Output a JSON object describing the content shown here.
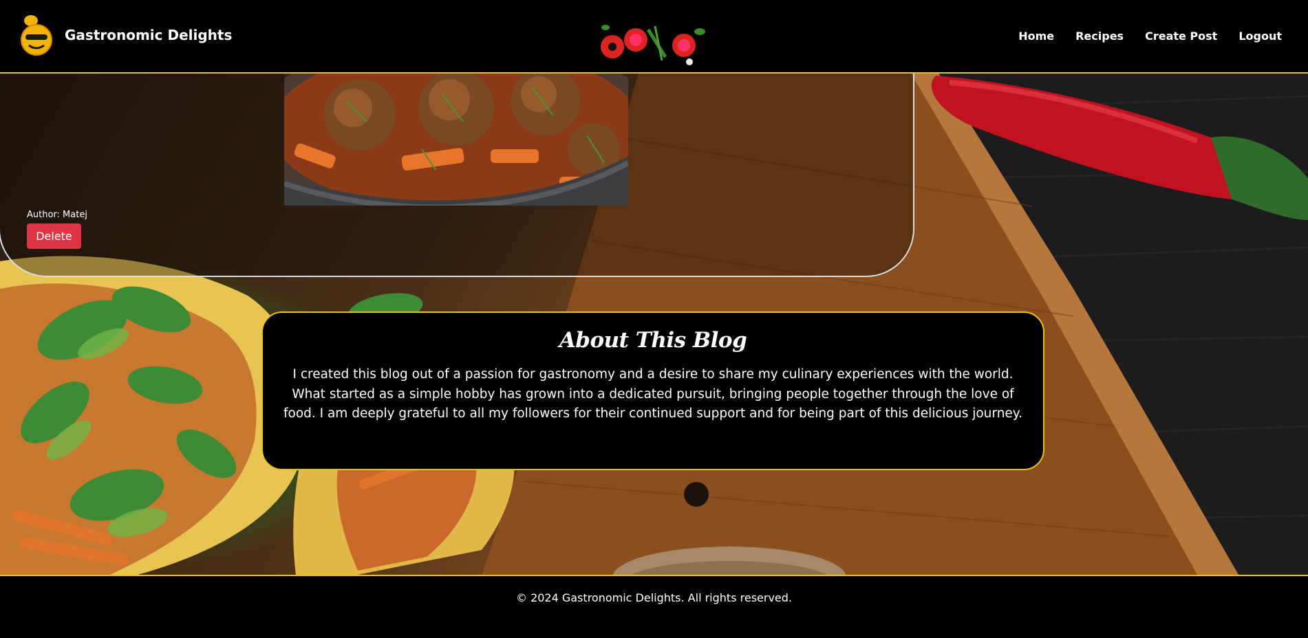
{
  "header": {
    "brand_name": "Gastronomic Delights",
    "nav": {
      "home": "Home",
      "recipes": "Recipes",
      "create_post": "Create Post",
      "logout": "Logout"
    }
  },
  "post": {
    "author": "Author: Matej",
    "delete_label": "Delete"
  },
  "about": {
    "title": "About This Blog",
    "text": "I created this blog out of a passion for gastronomy and a desire to share my culinary experiences with the world. What started as a simple hobby has grown into a dedicated pursuit, bringing people together through the love of food. I am deeply grateful to all my followers for their continued support and for being part of this delicious journey."
  },
  "footer": {
    "copyright": "© 2024 Gastronomic Delights. All rights reserved."
  },
  "colors": {
    "accent": "#e9c316",
    "delete": "#dc3545",
    "header_bg": "#000000"
  }
}
